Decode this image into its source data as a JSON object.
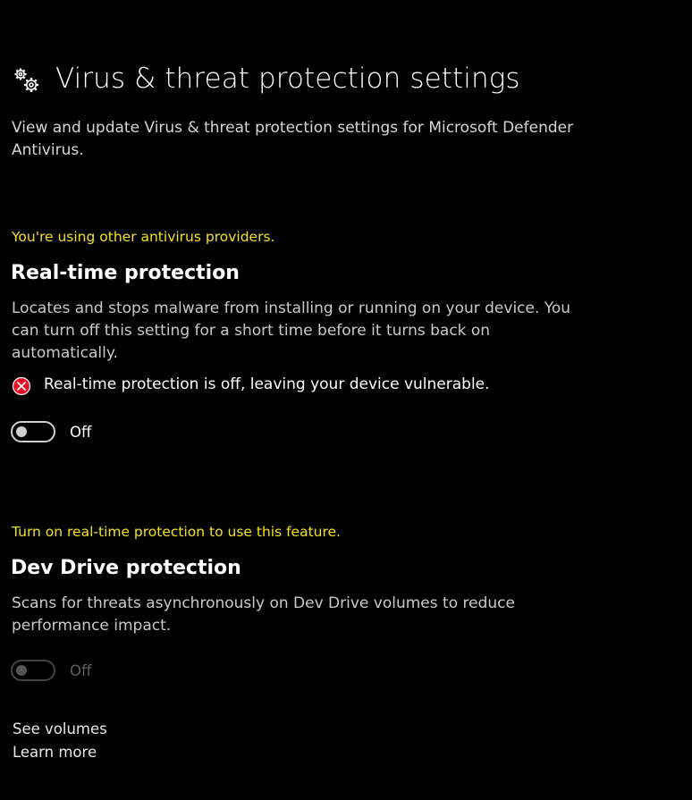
{
  "header": {
    "icon": "gears-icon",
    "title": "Virus & threat protection settings",
    "description": "View and update Virus & threat protection settings for Microsoft Defender Antivirus."
  },
  "realtime": {
    "warning": "You're using other antivirus providers.",
    "title": "Real-time protection",
    "description": "Locates and stops malware from installing or running on your device. You can turn off this setting for a short time before it turns back on automatically.",
    "status_icon": "error-circle-icon",
    "status_text": "Real-time protection is off, leaving your device vulnerable.",
    "toggle_label": "Off",
    "toggle_on": false
  },
  "devdrive": {
    "warning": "Turn on real-time protection to use this feature.",
    "title": "Dev Drive protection",
    "description": "Scans for threats asynchronously on Dev Drive volumes to reduce performance impact.",
    "toggle_label": "Off",
    "toggle_on": false,
    "toggle_disabled": true
  },
  "links": {
    "see_volumes": "See volumes",
    "learn_more": "Learn more"
  },
  "colors": {
    "background": "#000000",
    "warning": "#f3e21b",
    "error": "#e81123"
  }
}
